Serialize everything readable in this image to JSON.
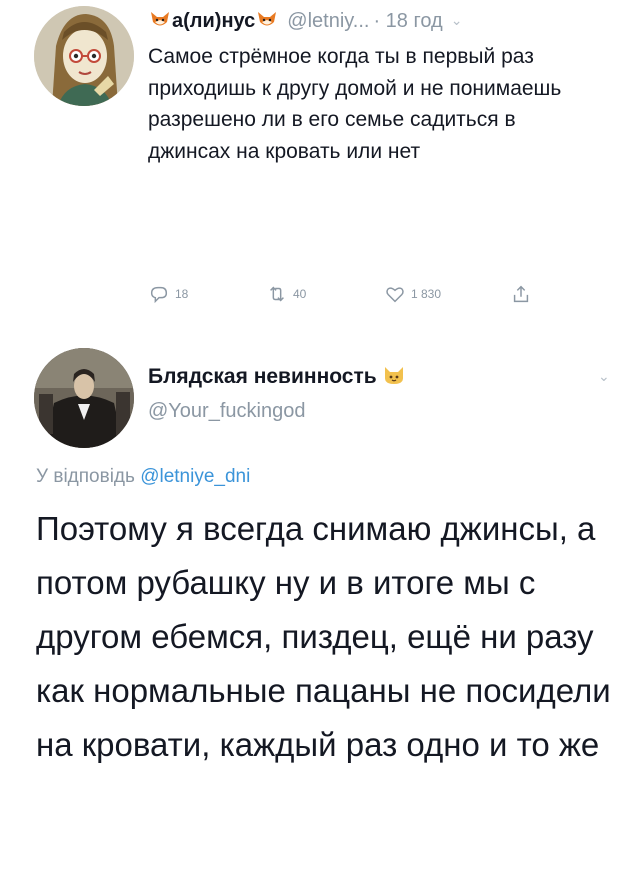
{
  "tweet": {
    "author_name": "а(ли)нус",
    "author_handle": "@letniy...",
    "time": "· 18 год",
    "text": "Самое стрёмное когда ты в первый раз приходишь к другу домой и не понимаешь разрешено ли в его семье садиться в джинсах на кровать или нет",
    "reply_count": "18",
    "retweet_count": "40",
    "like_count": "1 830",
    "name_emoji": "fox-face-icon"
  },
  "reply": {
    "author_name": "Блядская невинность",
    "author_handle": "@Your_fuckingod",
    "name_emoji": "cat-face-icon",
    "reply_prefix": "У відповідь",
    "reply_mention": "@letniye_dni",
    "text": "Поэтому я всегда снимаю джинсы, а потом рубашку ну и в итоге мы с другом ебемся, пиздец, ещё ни разу как нормальные пацаны не посидели на кровати, каждый раз одно и то же"
  },
  "colors": {
    "text": "#141823",
    "secondary": "#8b97a3",
    "link": "#3b94d9"
  }
}
